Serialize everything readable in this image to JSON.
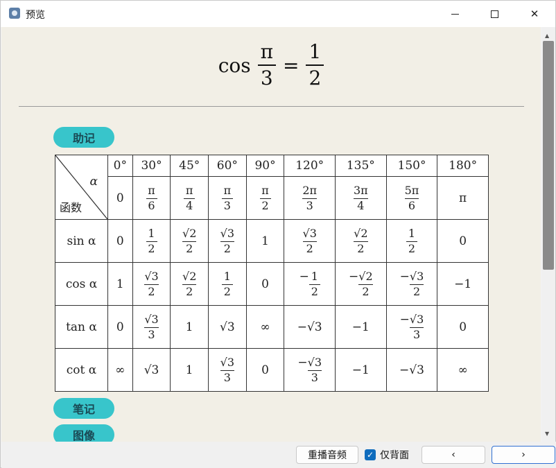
{
  "window": {
    "title": "预览",
    "minimize_icon": "minimize-icon",
    "maximize_icon": "maximize-icon",
    "close_icon": "close-icon"
  },
  "formula": {
    "func": "cos",
    "arg_num": "π",
    "arg_den": "3",
    "equals": "=",
    "result_num": "1",
    "result_den": "2"
  },
  "sections": {
    "mnemonic": "助记",
    "notes": "笔记",
    "graph": "图像"
  },
  "table": {
    "corner_alpha": "α",
    "corner_func": "函数",
    "degrees": [
      "0°",
      "30°",
      "45°",
      "60°",
      "90°",
      "120°",
      "135°",
      "150°",
      "180°"
    ],
    "radians": [
      {
        "t": "0"
      },
      {
        "n": "π",
        "d": "6"
      },
      {
        "n": "π",
        "d": "4"
      },
      {
        "n": "π",
        "d": "3"
      },
      {
        "n": "π",
        "d": "2"
      },
      {
        "n": "2π",
        "d": "3"
      },
      {
        "n": "3π",
        "d": "4"
      },
      {
        "n": "5π",
        "d": "6"
      },
      {
        "t": "π"
      }
    ],
    "rows": [
      {
        "label": "sin α",
        "cells": [
          {
            "t": "0"
          },
          {
            "n": "1",
            "d": "2"
          },
          {
            "n": "√2",
            "d": "2"
          },
          {
            "n": "√3",
            "d": "2"
          },
          {
            "t": "1"
          },
          {
            "n": "√3",
            "d": "2"
          },
          {
            "n": "√2",
            "d": "2"
          },
          {
            "n": "1",
            "d": "2"
          },
          {
            "t": "0"
          }
        ]
      },
      {
        "label": "cos α",
        "cells": [
          {
            "t": "1"
          },
          {
            "n": "√3",
            "d": "2"
          },
          {
            "n": "√2",
            "d": "2"
          },
          {
            "n": "1",
            "d": "2"
          },
          {
            "t": "0"
          },
          {
            "s": "−",
            "n": "1",
            "d": "2"
          },
          {
            "s": "−",
            "n": "√2",
            "d": "2"
          },
          {
            "s": "−",
            "n": "√3",
            "d": "2"
          },
          {
            "t": "−1"
          }
        ]
      },
      {
        "label": "tan α",
        "cells": [
          {
            "t": "0"
          },
          {
            "n": "√3",
            "d": "3"
          },
          {
            "t": "1"
          },
          {
            "t": "√3"
          },
          {
            "t": "∞"
          },
          {
            "t": "−√3"
          },
          {
            "t": "−1"
          },
          {
            "s": "−",
            "n": "√3",
            "d": "3"
          },
          {
            "t": "0"
          }
        ]
      },
      {
        "label": "cot α",
        "cells": [
          {
            "t": "∞"
          },
          {
            "t": "√3"
          },
          {
            "t": "1"
          },
          {
            "n": "√3",
            "d": "3"
          },
          {
            "t": "0"
          },
          {
            "s": "−",
            "n": "√3",
            "d": "3"
          },
          {
            "t": "−1"
          },
          {
            "t": "−√3"
          },
          {
            "t": "∞"
          }
        ]
      }
    ]
  },
  "bottom": {
    "replay_label": "重播音频",
    "back_only_label": "仅背面",
    "back_only_checked": true,
    "prev_label": "‹",
    "next_label": "›"
  },
  "colors": {
    "pill": "#38c5cb",
    "content_bg": "#f2efe6",
    "checkbox": "#0f6cbd"
  }
}
